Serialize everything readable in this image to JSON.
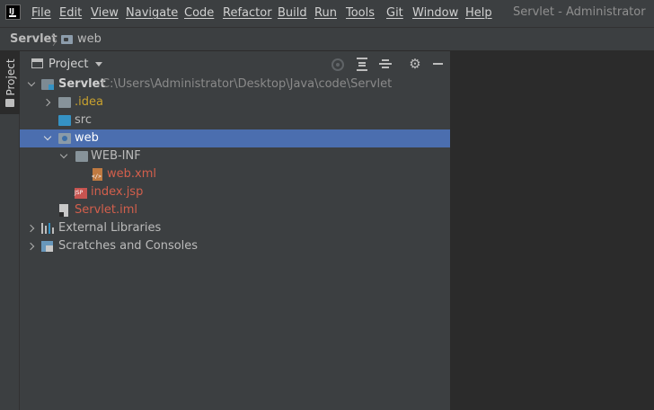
{
  "menubar": {
    "items": [
      "File",
      "Edit",
      "View",
      "Navigate",
      "Code",
      "Refactor",
      "Build",
      "Run",
      "Tools",
      "Git",
      "Window",
      "Help"
    ],
    "window_title": "Servlet - Administrator"
  },
  "breadcrumb": {
    "project": "Servlet",
    "folder": "web"
  },
  "toolstrip": {
    "project_tab": "Project"
  },
  "project_panel": {
    "title": "Project"
  },
  "tree": {
    "root": {
      "name": "Servlet",
      "path": "C:\\Users\\Administrator\\Desktop\\Java\\code\\Servlet"
    },
    "idea": ".idea",
    "src": "src",
    "web": "web",
    "webinf": "WEB-INF",
    "webxml": "web.xml",
    "indexjsp": "index.jsp",
    "iml": "Servlet.iml",
    "external_libraries": "External Libraries",
    "scratches": "Scratches and Consoles"
  },
  "colors": {
    "selection": "#4b6eaf",
    "idea_folder_text": "#c9a22e",
    "modified_file_text": "#d35f4c"
  }
}
